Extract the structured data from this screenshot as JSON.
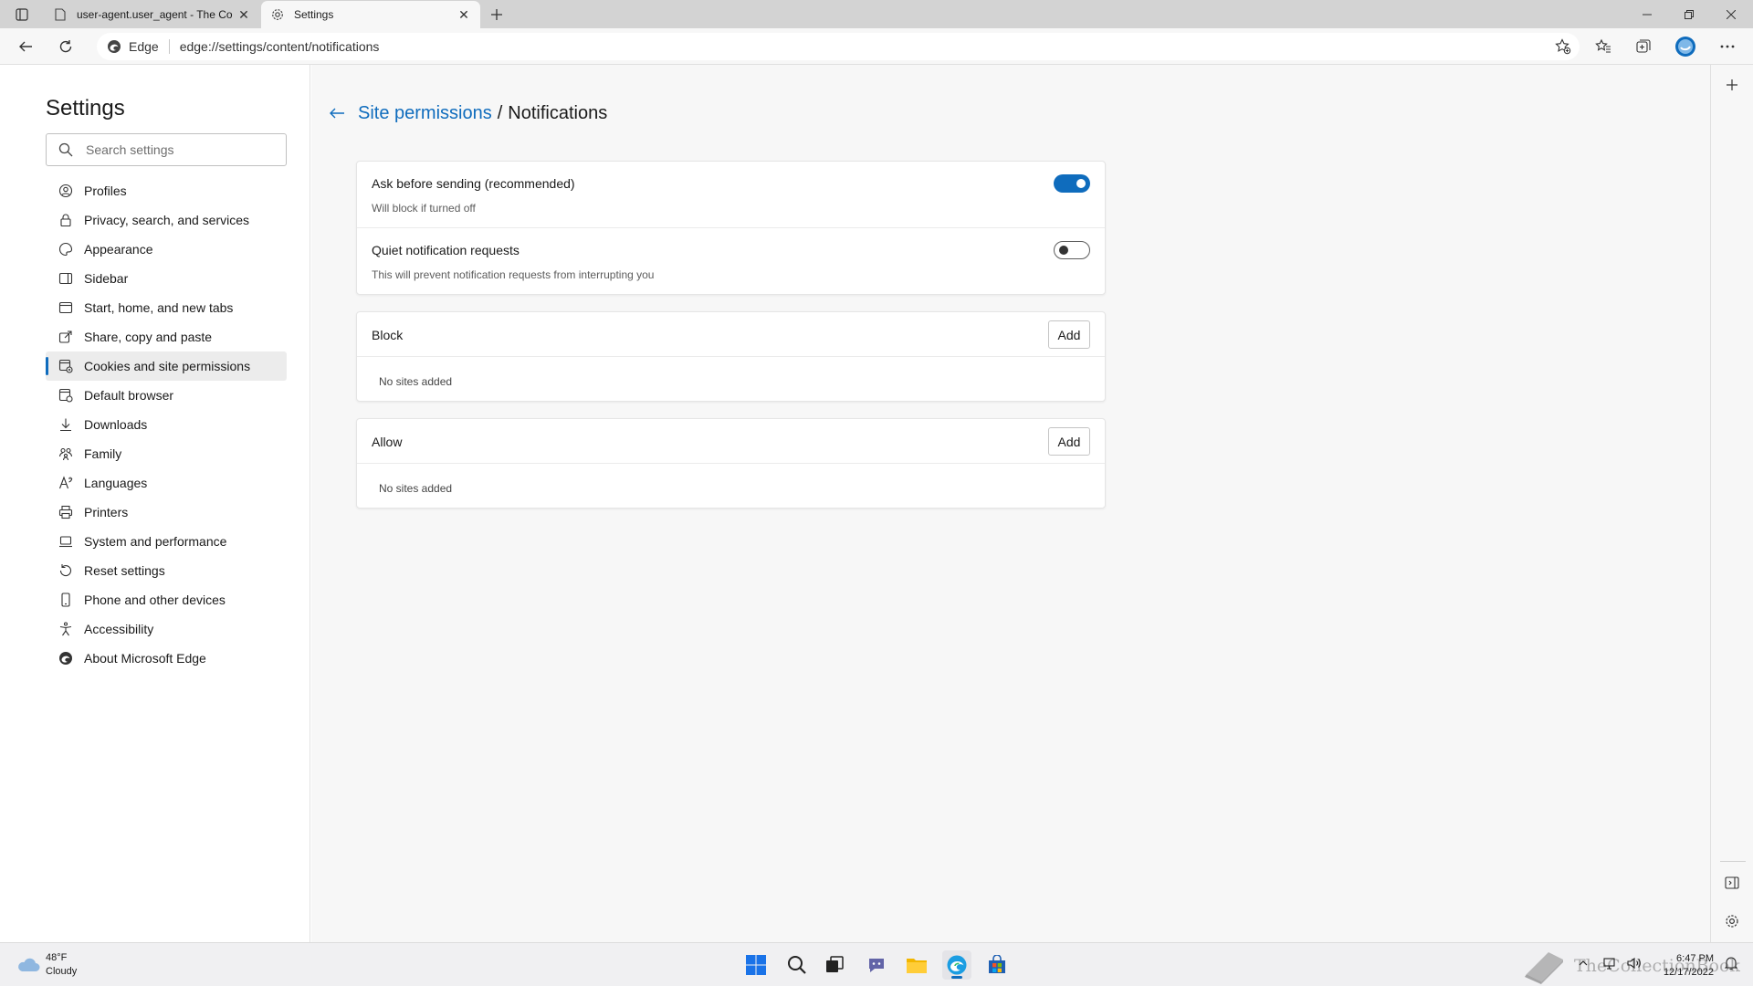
{
  "browser": {
    "tabs": [
      {
        "title": "user-agent.user_agent - The Coll",
        "active": false
      },
      {
        "title": "Settings",
        "active": true
      }
    ],
    "site_name": "Edge",
    "url": "edge://settings/content/notifications"
  },
  "settings": {
    "title": "Settings",
    "search_placeholder": "Search settings",
    "nav": [
      {
        "label": "Profiles",
        "icon": "profile-icon"
      },
      {
        "label": "Privacy, search, and services",
        "icon": "lock-icon"
      },
      {
        "label": "Appearance",
        "icon": "appearance-icon"
      },
      {
        "label": "Sidebar",
        "icon": "sidebar-icon"
      },
      {
        "label": "Start, home, and new tabs",
        "icon": "home-icon"
      },
      {
        "label": "Share, copy and paste",
        "icon": "share-icon"
      },
      {
        "label": "Cookies and site permissions",
        "icon": "cookies-icon",
        "selected": true
      },
      {
        "label": "Default browser",
        "icon": "browser-icon"
      },
      {
        "label": "Downloads",
        "icon": "download-icon"
      },
      {
        "label": "Family",
        "icon": "family-icon"
      },
      {
        "label": "Languages",
        "icon": "languages-icon"
      },
      {
        "label": "Printers",
        "icon": "printer-icon"
      },
      {
        "label": "System and performance",
        "icon": "laptop-icon"
      },
      {
        "label": "Reset settings",
        "icon": "reset-icon"
      },
      {
        "label": "Phone and other devices",
        "icon": "phone-icon"
      },
      {
        "label": "Accessibility",
        "icon": "accessibility-icon"
      },
      {
        "label": "About Microsoft Edge",
        "icon": "edge-logo-icon"
      }
    ]
  },
  "page": {
    "breadcrumb_parent": "Site permissions",
    "breadcrumb_separator": "/",
    "breadcrumb_current": "Notifications",
    "toggles": [
      {
        "label": "Ask before sending (recommended)",
        "description": "Will block if turned off",
        "on": true
      },
      {
        "label": "Quiet notification requests",
        "description": "This will prevent notification requests from interrupting you",
        "on": false
      }
    ],
    "block": {
      "title": "Block",
      "add_label": "Add",
      "empty_text": "No sites added"
    },
    "allow": {
      "title": "Allow",
      "add_label": "Add",
      "empty_text": "No sites added"
    }
  },
  "taskbar": {
    "weather_temp": "48°F",
    "weather_desc": "Cloudy",
    "time": "6:47 PM",
    "date": "12/17/2022",
    "watermark": "TheCollectionBook"
  },
  "colors": {
    "accent": "#0f6cbd",
    "tabstrip": "#d3d3d3",
    "page_bg": "#f7f7f7"
  }
}
